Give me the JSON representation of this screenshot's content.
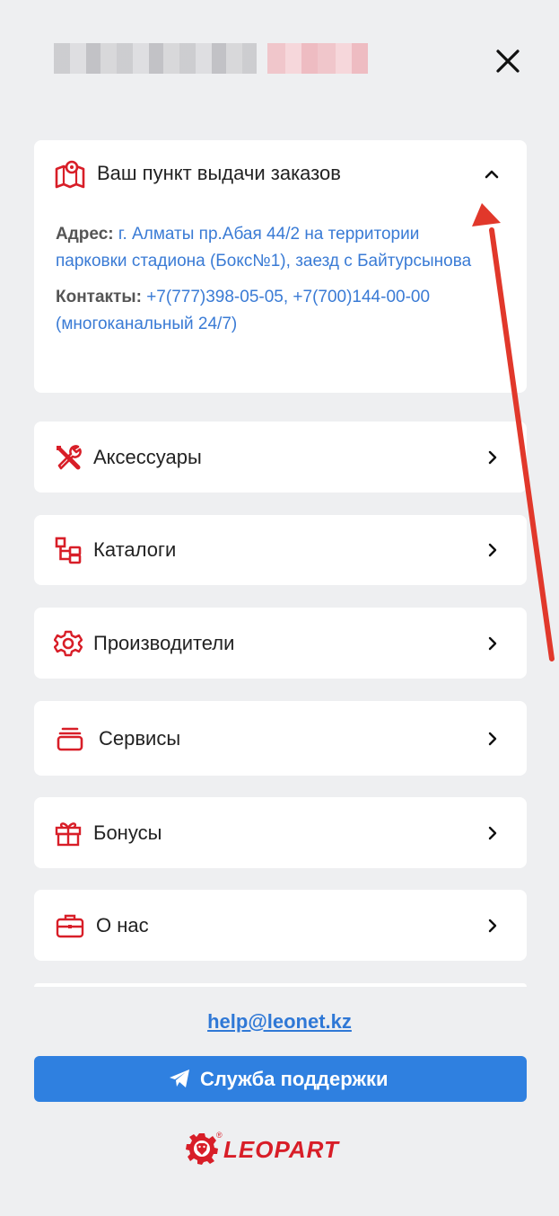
{
  "header": {
    "close_icon": "close-icon"
  },
  "pickup": {
    "title": "Ваш пункт выдачи заказов",
    "address_label": "Адрес:",
    "address_value": "г. Алматы пр.Абая 44/2 на территории парковки стадиона (Бокс№1), заезд с Байтурсынова",
    "contacts_label": "Контакты:",
    "contacts_value": "+7(777)398-05-05, +7(700)144-00-00 (многоканальный 24/7)",
    "icon": "map-pin-icon",
    "expanded": true
  },
  "menu": {
    "items": [
      {
        "label": "Аксессуары",
        "icon": "tools-icon"
      },
      {
        "label": "Каталоги",
        "icon": "catalog-icon"
      },
      {
        "label": "Производители",
        "icon": "gear-icon"
      },
      {
        "label": "Сервисы",
        "icon": "layers-icon"
      },
      {
        "label": "Бонусы",
        "icon": "gift-icon"
      },
      {
        "label": "О нас",
        "icon": "briefcase-icon"
      }
    ]
  },
  "footer": {
    "email": "help@leonet.kz",
    "support_button": "Служба поддержки",
    "logo_text": "LEOPART"
  },
  "colors": {
    "accent_red": "#d81e28",
    "link_blue": "#3a7bd5",
    "button_blue": "#2f80e0",
    "background": "#eeeff1"
  }
}
